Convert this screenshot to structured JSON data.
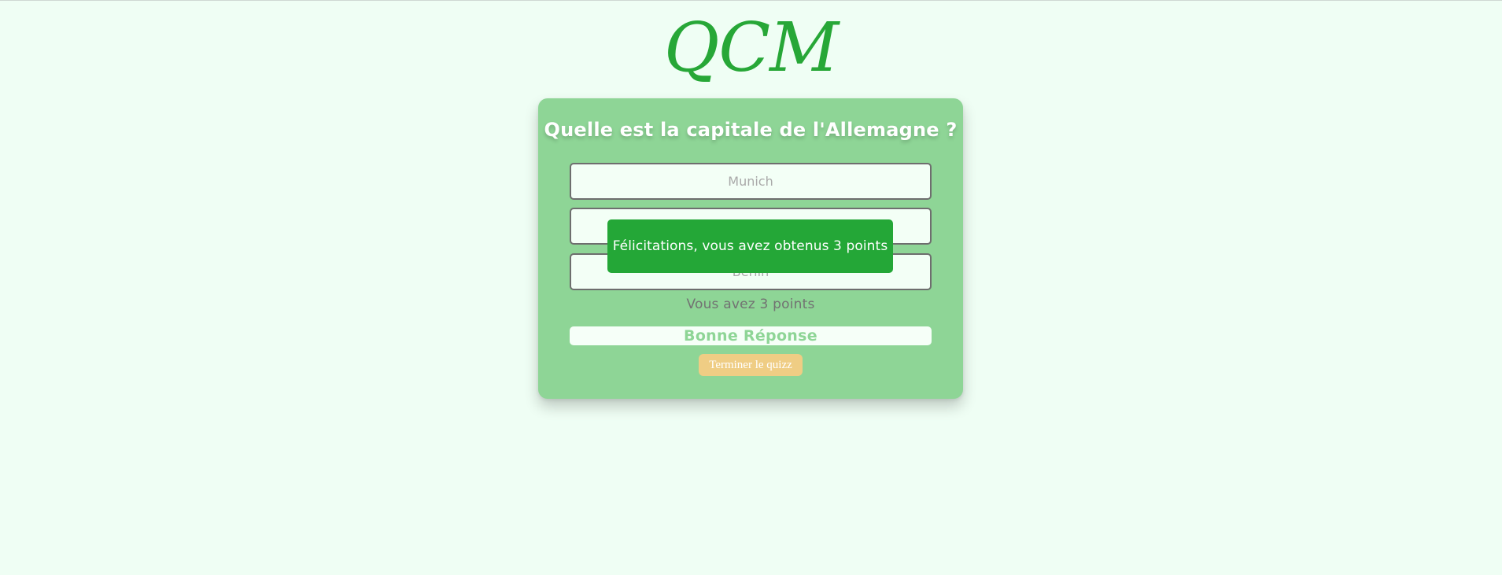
{
  "app": {
    "logo_text": "QCM"
  },
  "quiz": {
    "question": "Quelle est la capitale de l'Allemagne ?",
    "answers": [
      "Munich",
      "",
      "Berlin"
    ],
    "score_text": "Vous avez 3 points",
    "feedback_text": "Bonne Réponse",
    "finish_button_label": "Terminer le quizz"
  },
  "toast": {
    "message": "Félicitations, vous avez obtenus 3 points"
  },
  "colors": {
    "background": "#effef4",
    "card": "#8ed596",
    "brand_green": "#27a737",
    "toast_green": "#24a737",
    "finish_button": "#efcd84"
  }
}
